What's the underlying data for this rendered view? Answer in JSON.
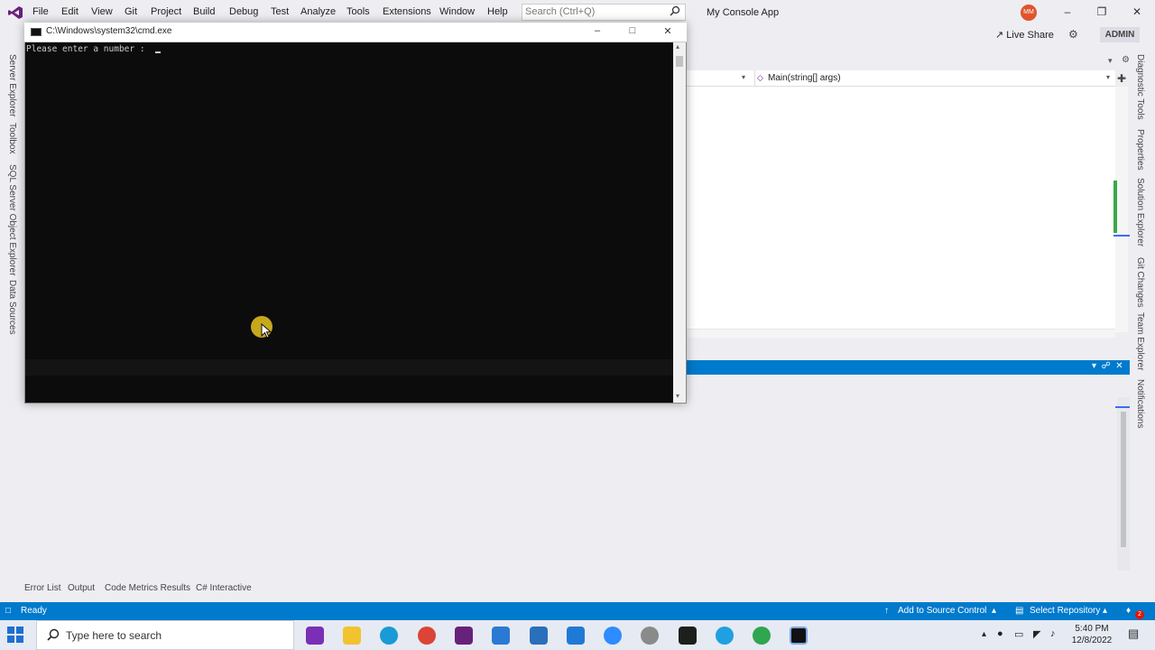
{
  "menu": {
    "items": [
      "File",
      "Edit",
      "View",
      "Git",
      "Project",
      "Build",
      "Debug",
      "Test",
      "Analyze",
      "Tools",
      "Extensions",
      "Window",
      "Help"
    ],
    "search_placeholder": "Search (Ctrl+Q)",
    "app_title": "My Console App",
    "avatar_initials": "MM",
    "live_share": "Live Share",
    "admin": "ADMIN"
  },
  "left_tabs": [
    "Server Explorer",
    "Toolbox",
    "SQL Server Object Explorer",
    "Data Sources"
  ],
  "right_tabs": [
    "Diagnostic Tools",
    "Properties",
    "Solution Explorer",
    "Git Changes",
    "Team Explorer",
    "Notifications"
  ],
  "editor": {
    "member_dropdown": "Main(string[] args)"
  },
  "cmd": {
    "title": "C:\\Windows\\system32\\cmd.exe",
    "output_line": "Please enter a number : "
  },
  "bottom_tabs": [
    "Error List",
    "Output",
    "Code Metrics Results",
    "C# Interactive"
  ],
  "status": {
    "ready": "Ready",
    "add_source_control": "Add to Source Control",
    "select_repository": "Select Repository",
    "notifications_count": "2"
  },
  "taskbar": {
    "search_placeholder": "Type here to search",
    "time": "5:40 PM",
    "date": "12/8/2022"
  },
  "colors": {
    "accent": "#007acc",
    "vs_purple": "#68217a",
    "console_bg": "#0c0c0c",
    "mouse_highlight": "#dcb91e"
  }
}
